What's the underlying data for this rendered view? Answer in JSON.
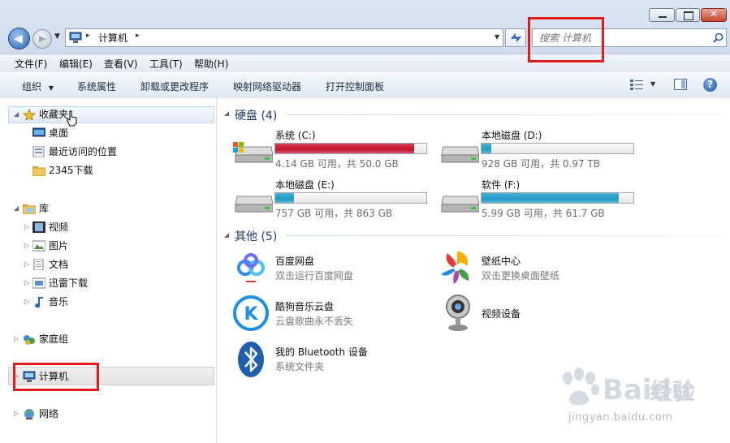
{
  "window": {
    "address": {
      "root_glyph": "▸",
      "crumb": "计算机",
      "trail_arrow": "▸"
    },
    "search": {
      "placeholder": "搜索 计算机"
    }
  },
  "menubar": [
    "文件(F)",
    "编辑(E)",
    "查看(V)",
    "工具(T)",
    "帮助(H)"
  ],
  "toolbar": {
    "organize": "组织",
    "items": [
      "系统属性",
      "卸载或更改程序",
      "映射网络驱动器",
      "打开控制面板"
    ]
  },
  "nav": {
    "favorites": {
      "label": "收藏夹",
      "items": [
        "桌面",
        "最近访问的位置",
        "2345下载"
      ]
    },
    "libraries": {
      "label": "库",
      "items": [
        "视频",
        "图片",
        "文档",
        "迅雷下载",
        "音乐"
      ]
    },
    "homegroup": "家庭组",
    "computer": "计算机",
    "network": "网络"
  },
  "content": {
    "hard_disks_header": "硬盘 (4)",
    "drives": [
      {
        "name": "系统 (C:)",
        "free_text": "4.14 GB 可用，共 50.0 GB",
        "used_fraction": 0.917,
        "status": "critical"
      },
      {
        "name": "本地磁盘 (D:)",
        "free_text": "928 GB 可用，共 0.97 TB",
        "used_fraction": 0.066,
        "status": "normal"
      },
      {
        "name": "本地磁盘 (E:)",
        "free_text": "757 GB 可用，共 863 GB",
        "used_fraction": 0.123,
        "status": "normal"
      },
      {
        "name": "软件 (F:)",
        "free_text": "5.99 GB 可用，共 61.7 GB",
        "used_fraction": 0.903,
        "status": "normal"
      }
    ],
    "other_header": "其他 (5)",
    "others": [
      {
        "name": "百度网盘",
        "sub": "双击运行百度网盘",
        "icon": "baidu-netdisk-icon"
      },
      {
        "name": "壁纸中心",
        "sub": "双击更换桌面壁纸",
        "icon": "wallpaper-center-icon"
      },
      {
        "name": "酷狗音乐云盘",
        "sub": "云盘歌曲永不丢失",
        "icon": "kugou-cloud-icon"
      },
      {
        "name": "视频设备",
        "sub": "",
        "icon": "webcam-icon"
      },
      {
        "name": "我的 Bluetooth 设备",
        "sub": "系统文件夹",
        "icon": "bluetooth-icon"
      }
    ]
  },
  "watermark": {
    "brand_left": "Bai",
    "brand_mid": "du",
    "brand_right": "经验",
    "url": "jingyan.baidu.com"
  },
  "colors": {
    "critical_bar": "#c8102e",
    "normal_bar": "#1e9bc7",
    "annotation_red": "#e31b1b"
  }
}
